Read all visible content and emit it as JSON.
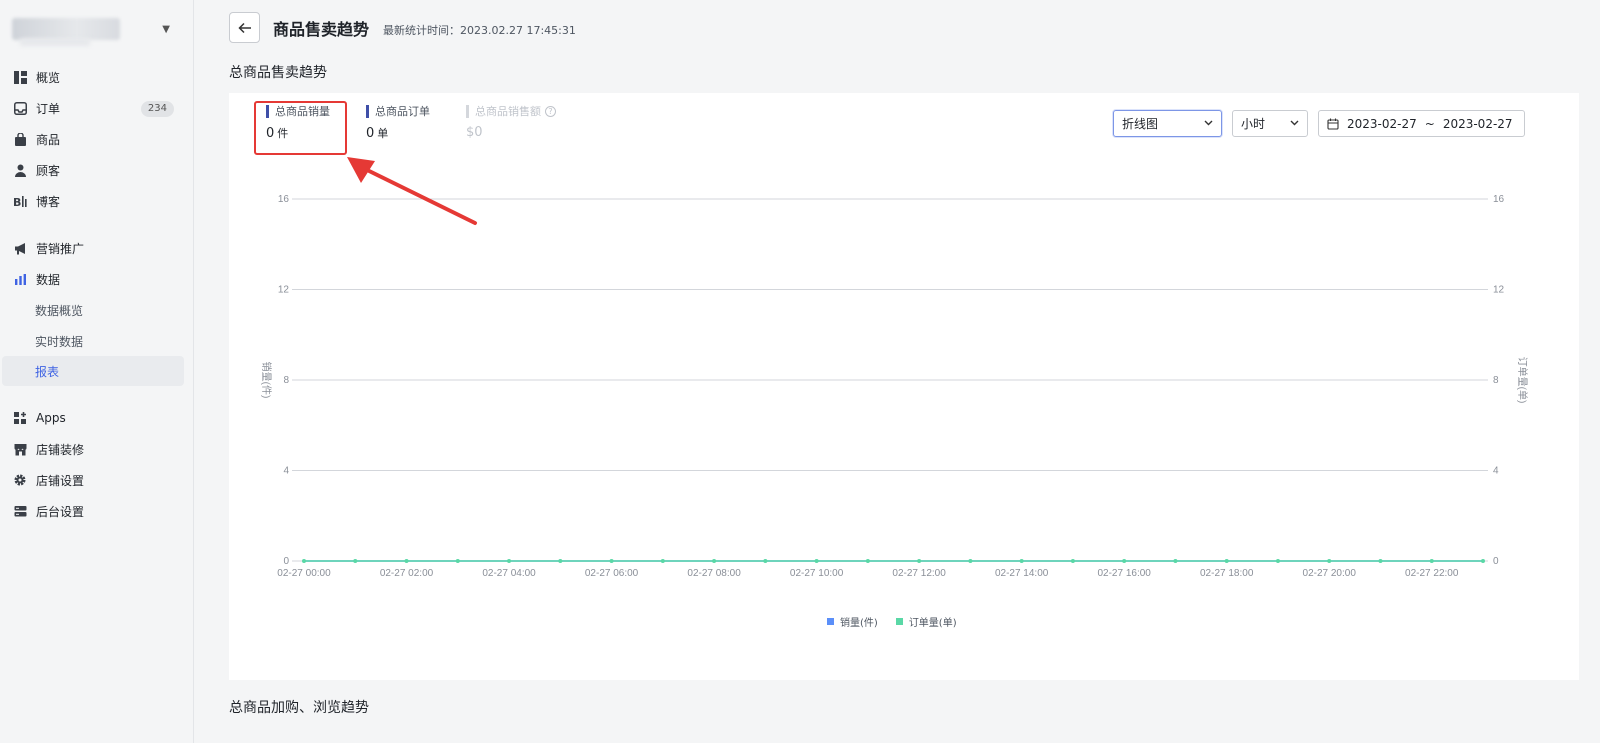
{
  "sidebar": {
    "items": [
      {
        "label": "概览",
        "icon": "dashboard-icon"
      },
      {
        "label": "订单",
        "icon": "inbox-icon",
        "badge": "234"
      },
      {
        "label": "商品",
        "icon": "bag-icon"
      },
      {
        "label": "顾客",
        "icon": "person-icon"
      },
      {
        "label": "博客",
        "icon": "blog-icon"
      },
      {
        "label": "营销推广",
        "icon": "megaphone-icon"
      },
      {
        "label": "数据",
        "icon": "bar-chart-icon"
      },
      {
        "label": "数据概览"
      },
      {
        "label": "实时数据"
      },
      {
        "label": "报表"
      },
      {
        "label": "Apps",
        "icon": "apps-icon"
      },
      {
        "label": "店铺装修",
        "icon": "store-icon"
      },
      {
        "label": "店铺设置",
        "icon": "gear-icon"
      },
      {
        "label": "后台设置",
        "icon": "server-icon"
      }
    ]
  },
  "header": {
    "title": "商品售卖趋势",
    "meta": "最新统计时间：2023.02.27 17:45:31"
  },
  "section1": {
    "title": "总商品售卖趋势"
  },
  "section2": {
    "title": "总商品加购、浏览趋势"
  },
  "metrics": [
    {
      "label": "总商品销量",
      "value": "0",
      "unit": "件"
    },
    {
      "label": "总商品订单",
      "value": "0",
      "unit": "单"
    },
    {
      "label": "总商品销售额",
      "value": "$0",
      "unit": ""
    }
  ],
  "controls": {
    "chart_type": "折线图",
    "granularity": "小时",
    "date_start": "2023-02-27",
    "date_sep": "~",
    "date_end": "2023-02-27"
  },
  "chart_data": {
    "type": "line",
    "x": [
      "02-27 00:00",
      "02-27 01:00",
      "02-27 02:00",
      "02-27 03:00",
      "02-27 04:00",
      "02-27 05:00",
      "02-27 06:00",
      "02-27 07:00",
      "02-27 08:00",
      "02-27 09:00",
      "02-27 10:00",
      "02-27 11:00",
      "02-27 12:00",
      "02-27 13:00",
      "02-27 14:00",
      "02-27 15:00",
      "02-27 16:00",
      "02-27 17:00",
      "02-27 18:00",
      "02-27 19:00",
      "02-27 20:00",
      "02-27 21:00",
      "02-27 22:00",
      "02-27 23:00"
    ],
    "x_tick_labels": [
      "02-27 00:00",
      "02-27 02:00",
      "02-27 04:00",
      "02-27 06:00",
      "02-27 08:00",
      "02-27 10:00",
      "02-27 12:00",
      "02-27 14:00",
      "02-27 16:00",
      "02-27 18:00",
      "02-27 20:00",
      "02-27 22:00"
    ],
    "series": [
      {
        "name": "销量(件)",
        "values": [
          0,
          0,
          0,
          0,
          0,
          0,
          0,
          0,
          0,
          0,
          0,
          0,
          0,
          0,
          0,
          0,
          0,
          0,
          0,
          0,
          0,
          0,
          0,
          0
        ],
        "color": "#5b8ff9",
        "axis": "left"
      },
      {
        "name": "订单量(单)",
        "values": [
          0,
          0,
          0,
          0,
          0,
          0,
          0,
          0,
          0,
          0,
          0,
          0,
          0,
          0,
          0,
          0,
          0,
          0,
          0,
          0,
          0,
          0,
          0,
          0
        ],
        "color": "#5ad8a6",
        "axis": "right"
      }
    ],
    "y_ticks": [
      0,
      4,
      8,
      12,
      16
    ],
    "ylim": [
      0,
      16
    ],
    "ylabel_left": "销量(件)",
    "ylabel_right": "订单量(单)",
    "grid": true,
    "legend": "bottom"
  },
  "colors": {
    "accent": "#3f63e3",
    "highlight": "#e53935"
  }
}
